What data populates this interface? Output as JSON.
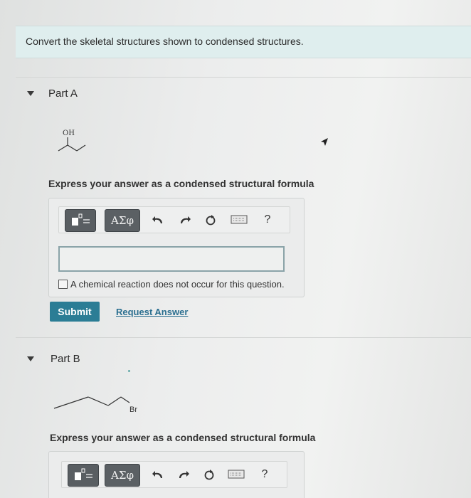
{
  "prompt": "Convert the skeletal structures shown to condensed structures.",
  "partA": {
    "title": "Part A",
    "molecule_label": "OH",
    "instruction": "Express your answer as a condensed structural formula",
    "toolbar": {
      "greek_label": "ΑΣφ",
      "help_label": "?"
    },
    "answer_value": "",
    "checkbox_label": "A chemical reaction does not occur for this question.",
    "submit_label": "Submit",
    "request_label": "Request Answer"
  },
  "partB": {
    "title": "Part B",
    "molecule_label": "Br",
    "instruction": "Express your answer as a condensed structural formula",
    "toolbar": {
      "greek_label": "ΑΣφ",
      "help_label": "?"
    }
  },
  "colors": {
    "prompt_bg": "#dfeeee",
    "submit_bg": "#2b7d95",
    "link": "#2b6f90",
    "toolbar_button": "#5b6064"
  },
  "icons": [
    "templates-icon",
    "undo-icon",
    "redo-icon",
    "reset-icon",
    "keyboard-icon",
    "help-icon",
    "caret-down-icon",
    "mouse-cursor-icon"
  ]
}
